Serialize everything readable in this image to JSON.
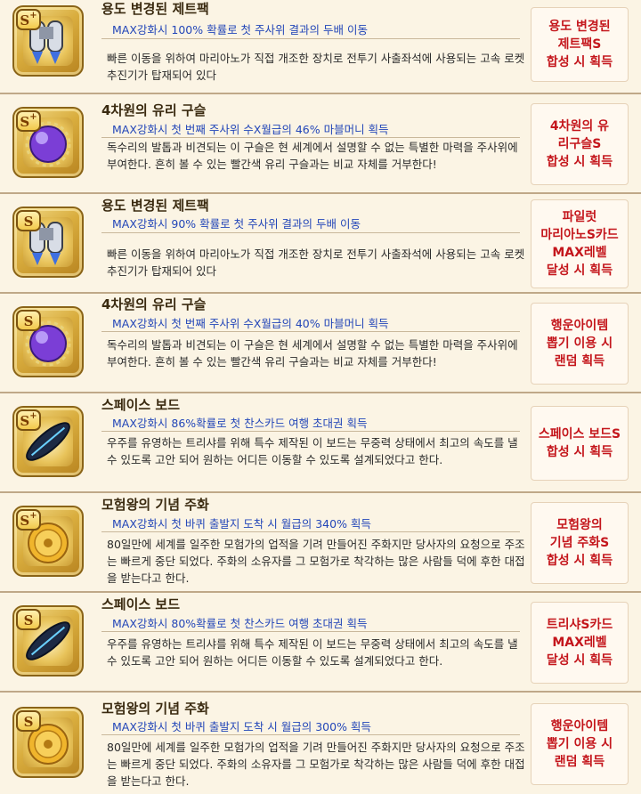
{
  "items": [
    {
      "grade": "S",
      "plus": "+",
      "icon": "jetpack-icon",
      "title": "용도 변경된 제트팩",
      "effect": "MAX강화시  100% 확률로 첫 주사위 결과의 두배 이동",
      "desc": "빠른 이동을 위하여 마리아노가 직접 개조한 장치로 전투기 사출좌석에 사용되는 고속 로켓 추진기가 탑재되어 있다",
      "obtain": "용도 변경된\n제트팩S\n합성 시 획득"
    },
    {
      "grade": "S",
      "plus": "+",
      "icon": "crystal-orb-icon",
      "title": "4차원의 유리 구슬",
      "effect": "MAX강화시  첫 번째 주사위 수X월급의 46% 마블머니 획득",
      "desc": "독수리의 발톱과 비견되는 이 구슬은 현 세계에서 설명할 수 없는 특별한 마력을 주사위에 부여한다. 흔히 볼 수 있는 빨간색 유리 구슬과는 비교 자체를 거부한다!",
      "obtain": "4차원의 유\n리구슬S\n합성 시 획득"
    },
    {
      "grade": "S",
      "plus": "",
      "icon": "jetpack-icon",
      "title": "용도 변경된 제트팩",
      "effect": "MAX강화시  90% 확률로 첫 주사위 결과의 두배 이동",
      "desc": "빠른 이동을 위하여 마리아노가 직접 개조한 장치로 전투기 사출좌석에 사용되는 고속 로켓 추진기가 탑재되어 있다",
      "obtain": "파일럿\n마리아노S카드\nMAX레벨\n달성 시 획득"
    },
    {
      "grade": "S",
      "plus": "",
      "icon": "crystal-orb-icon",
      "title": "4차원의 유리 구슬",
      "effect": "MAX강화시  첫 번째 주사위 수X월급의 40% 마블머니 획득",
      "desc": "독수리의 발톱과 비견되는 이 구슬은 현 세계에서 설명할 수 없는 특별한 마력을 주사위에 부여한다. 흔히 볼 수 있는 빨간색 유리 구슬과는 비교 자체를 거부한다!",
      "obtain": "행운아이템\n뽑기 이용 시\n랜덤 획득"
    },
    {
      "grade": "S",
      "plus": "+",
      "icon": "space-board-icon",
      "title": "스페이스 보드",
      "effect": "MAX강화시  86%확률로 첫 찬스카드 여행 초대권 획득",
      "desc": "우주를 유영하는 트리샤를 위해 특수 제작된 이 보드는 무중력 상태에서 최고의 속도를 낼 수 있도록 고안 되어 원하는 어디든 이동할 수 있도록 설계되었다고 한다.",
      "obtain": "스페이스 보드S\n합성 시 획득"
    },
    {
      "grade": "S",
      "plus": "+",
      "icon": "gold-coin-icon",
      "title": "모험왕의 기념 주화",
      "effect": "MAX강화시  첫 바퀴 출발지 도착 시 월급의 340% 획득",
      "desc": "80일만에 세계를 일주한 모험가의 업적을 기려 만들어진 주화지만 당사자의 요청으로 주조는 빠르게 중단 되었다. 주화의 소유자를 그 모험가로 착각하는 많은 사람들 덕에 후한 대접을 받는다고 한다.",
      "obtain": "모험왕의\n기념 주화S\n합성 시 획득"
    },
    {
      "grade": "S",
      "plus": "",
      "icon": "space-board-icon",
      "title": "스페이스 보드",
      "effect": "MAX강화시  80%확률로 첫 찬스카드 여행 초대권 획득",
      "desc": "우주를 유영하는 트리샤를 위해 특수 제작된 이 보드는 무중력 상태에서 최고의 속도를 낼 수 있도록 고안 되어 원하는 어디든 이동할 수 있도록 설계되었다고 한다.",
      "obtain": "트리샤S카드\nMAX레벨\n달성 시 획득"
    },
    {
      "grade": "S",
      "plus": "",
      "icon": "gold-coin-icon",
      "title": "모험왕의 기념 주화",
      "effect": "MAX강화시  첫 바퀴 출발지 도착 시 월급의 300% 획득",
      "desc": "80일만에 세계를 일주한 모험가의 업적을 기려 만들어진 주화지만 당사자의 요청으로 주조는 빠르게 중단 되었다. 주화의 소유자를 그 모험가로 착각하는 많은 사람들 덕에 후한 대접을 받는다고 한다.",
      "obtain": "행운아이템\n뽑기 이용 시\n랜덤 획득"
    }
  ]
}
